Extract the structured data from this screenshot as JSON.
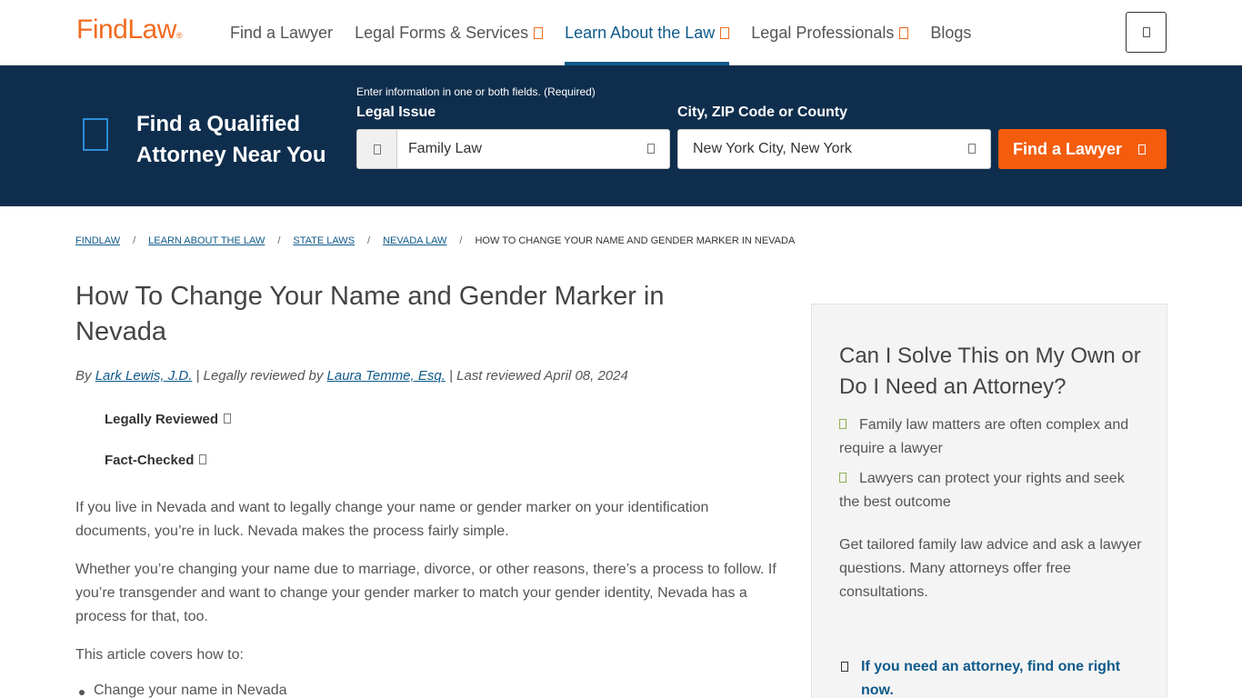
{
  "header": {
    "logo": "FindLaw",
    "logo_mark": "®",
    "nav": [
      {
        "label": "Find a Lawyer",
        "chevron": false,
        "active": false
      },
      {
        "label": "Legal Forms & Services",
        "chevron": true,
        "active": false
      },
      {
        "label": "Learn About the Law",
        "chevron": true,
        "active": true
      },
      {
        "label": "Legal Professionals",
        "chevron": true,
        "active": false
      },
      {
        "label": "Blogs",
        "chevron": false,
        "active": false
      }
    ],
    "menu_icon": "menu-icon"
  },
  "search_band": {
    "title": "Find a Qualified Attorney Near You",
    "hint": "Enter information in one or both fields. (Required)",
    "issue_label": "Legal Issue",
    "issue_value": "Family Law",
    "location_label": "City, ZIP Code or County",
    "location_value": "New York City, New York",
    "button_label": "Find a Lawyer"
  },
  "breadcrumb": {
    "items": [
      "FINDLAW",
      "LEARN ABOUT THE LAW",
      "STATE LAWS",
      "NEVADA LAW"
    ],
    "separator": "/",
    "current": "HOW TO CHANGE YOUR NAME AND GENDER MARKER IN NEVADA"
  },
  "article": {
    "title": "How To Change Your Name and Gender Marker in Nevada",
    "by_prefix": "By ",
    "author": "Lark Lewis, J.D.",
    "reviewed_prefix": " | Legally reviewed by ",
    "reviewer": "Laura Temme, Esq.",
    "last_reviewed": " | Last reviewed April 08, 2024",
    "badge_reviewed": "Legally Reviewed",
    "badge_checked": "Fact-Checked",
    "paragraphs": [
      "If you live in Nevada and want to legally change your name or gender marker on your identification documents, you’re in luck. Nevada makes the process fairly simple.",
      "Whether you’re changing your name due to marriage, divorce, or other reasons, there’s a process to follow. If you’re transgender and want to change your gender marker to match your gender identity, Nevada has a process for that, too.",
      "This article covers how to:"
    ],
    "bullet_1": "Change your name in Nevada"
  },
  "sidebar": {
    "title": "Can I Solve This on My Own or Do I Need an Attorney?",
    "checks": [
      "Family law matters are often complex and require a lawyer",
      "Lawyers can protect your rights and seek the best outcome"
    ],
    "text": "Get tailored family law advice and ask a lawyer questions. Many attorneys offer free consultations.",
    "cta": "If you need an attorney, find one right now."
  }
}
